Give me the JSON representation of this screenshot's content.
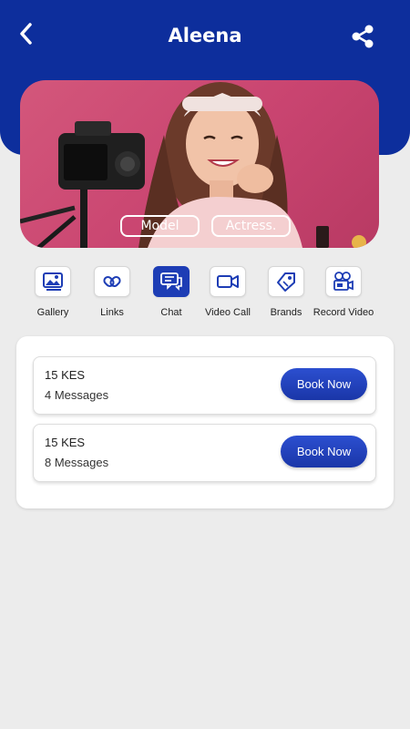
{
  "header": {
    "title": "Aleena",
    "back_icon": "chevron-left-icon",
    "share_icon": "share-icon",
    "color": "#0d2e9c"
  },
  "hero": {
    "image": "woman-with-camera-photo",
    "tags": [
      "Model",
      "Actress."
    ]
  },
  "actions": [
    {
      "label": "Gallery",
      "icon": "image-icon",
      "active": false
    },
    {
      "label": "Links",
      "icon": "link-icon",
      "active": false
    },
    {
      "label": "Chat",
      "icon": "chat-icon",
      "active": true
    },
    {
      "label": "Video Call",
      "icon": "video-icon",
      "active": false
    },
    {
      "label": "Brands",
      "icon": "tag-icon",
      "active": false
    },
    {
      "label": "Record Video",
      "icon": "video-camera-icon",
      "active": false
    }
  ],
  "offers": [
    {
      "price": "15 KES",
      "messages": "4 Messages",
      "button": "Book Now"
    },
    {
      "price": "15 KES",
      "messages": "8 Messages",
      "button": "Book Now"
    }
  ],
  "colors": {
    "accent": "#1d3db5",
    "background": "#ececec"
  }
}
